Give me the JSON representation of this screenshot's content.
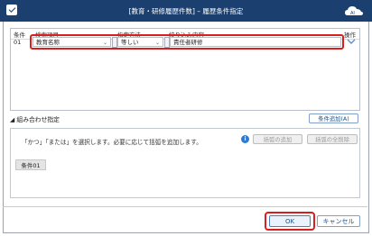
{
  "window": {
    "title": "[教育・研修履歴件数] – 履歴条件指定"
  },
  "grid": {
    "headers": {
      "condition": "条件",
      "search_item": "検索項目",
      "method": "指定方法",
      "content": "絞り込み内容",
      "operation": "操作"
    },
    "rows": [
      {
        "no": "01",
        "search_item": "教育名称",
        "method": "等しい",
        "content": "責任者研修"
      }
    ]
  },
  "combination": {
    "title": "組み合わせ指定",
    "add_condition_button": "条件追加(A)",
    "hint": "「かつ」「または」を選択します。必要に応じて括弧を追加します。",
    "add_paren_button": "括弧の追加",
    "remove_all_parens_button": "括弧の全削除",
    "condition_chip": "条件01"
  },
  "footer": {
    "ok_button": "OK",
    "cancel_button": "キャンセル"
  },
  "colors": {
    "title_bar": "#1b3f6e",
    "highlight": "#d81e1e",
    "info": "#2e7bd6"
  }
}
